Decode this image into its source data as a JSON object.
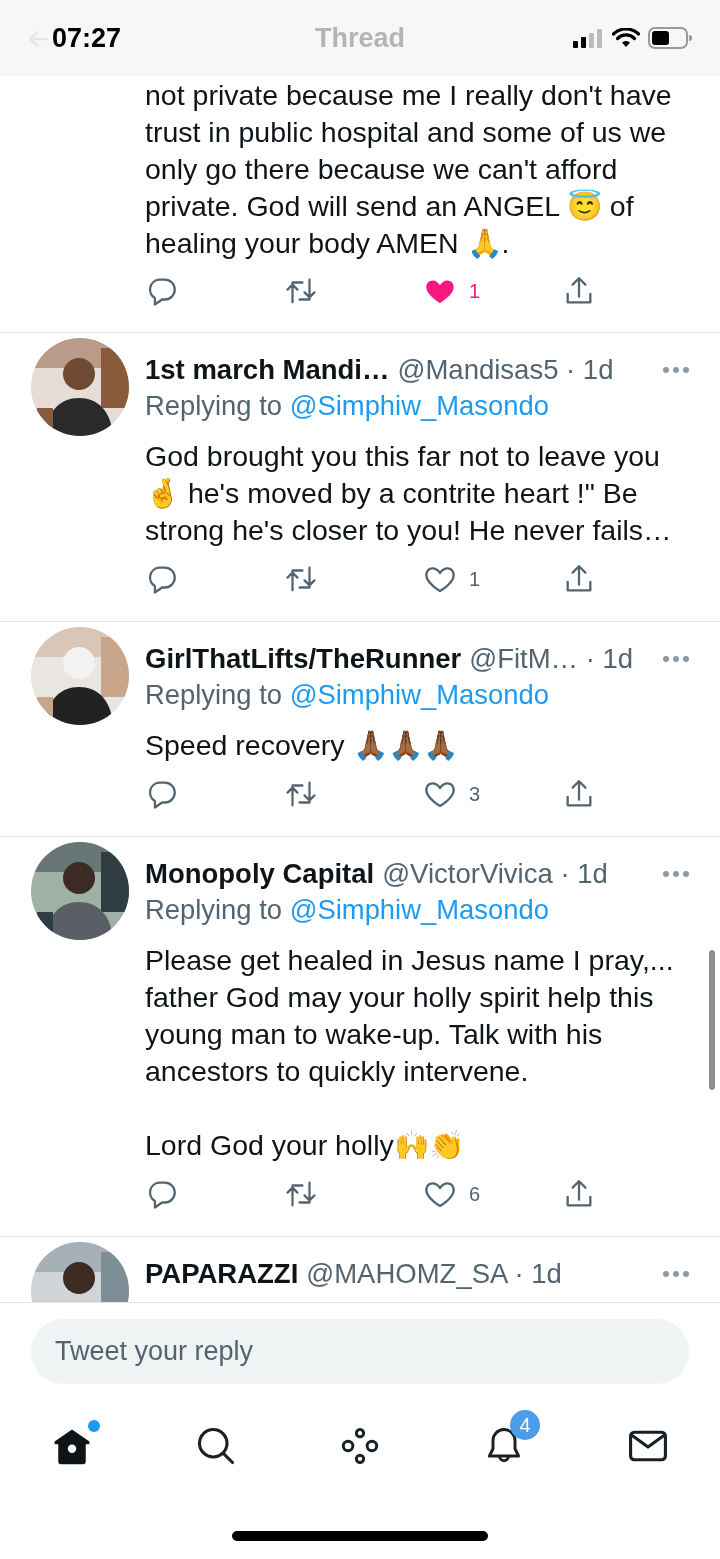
{
  "status_bar": {
    "time": "07:27"
  },
  "header": {
    "title": "Thread"
  },
  "tweets": [
    {
      "kind": "partial",
      "paragraphs": [
        "not private because me I really don't have trust in public hospital and some of us we only go there because we can't afford private.  God will send an ANGEL 😇 of healing your body AMEN 🙏."
      ],
      "like": {
        "liked": true,
        "count": "1"
      }
    },
    {
      "kind": "full",
      "avatar": {
        "kind": "picture"
      },
      "name": "1st march Mandi…",
      "handle_line": "@Mandisas5 · 1d",
      "replying_label": "Replying to",
      "replying_to": "@Simphiw_Masondo",
      "paragraphs": [
        "God brought you this far not to leave you 🤞 he's moved by a contrite heart !\" Be strong he's closer to you! He never fails…"
      ],
      "like": {
        "liked": false,
        "count": "1"
      }
    },
    {
      "kind": "full",
      "avatar": {
        "kind": "picture"
      },
      "name": "GirlThatLifts/TheRunner",
      "handle_line": "@FitM… · 1d",
      "replying_label": "Replying to",
      "replying_to": "@Simphiw_Masondo",
      "paragraphs": [
        "Speed recovery 🙏🏾🙏🏾🙏🏾"
      ],
      "like": {
        "liked": false,
        "count": "3"
      }
    },
    {
      "kind": "full",
      "avatar": {
        "kind": "picture"
      },
      "name": "Monopoly Capital",
      "handle_line": "@VictorVivica · 1d",
      "replying_label": "Replying to",
      "replying_to": "@Simphiw_Masondo",
      "paragraphs": [
        "Please get healed in Jesus name I pray,... father God may your holly spirit help this young man to wake-up. Talk with his ancestors to quickly intervene.",
        "Lord God your holly🙌👏"
      ],
      "like": {
        "liked": false,
        "count": "6"
      }
    },
    {
      "kind": "header_only",
      "avatar": {
        "kind": "picture"
      },
      "name": "PAPARAZZI",
      "handle_line": "@MAHOMZ_SA · 1d"
    }
  ],
  "reply_field": {
    "placeholder": "Tweet your reply"
  },
  "tabs": [
    {
      "kind": "home",
      "selected": true,
      "dot": true
    },
    {
      "kind": "search",
      "selected": false,
      "dot": false
    },
    {
      "kind": "spaces",
      "selected": false,
      "dot": false
    },
    {
      "kind": "notifications",
      "selected": false,
      "dot": false,
      "badge": "4"
    },
    {
      "kind": "messages",
      "selected": false,
      "dot": false
    }
  ]
}
